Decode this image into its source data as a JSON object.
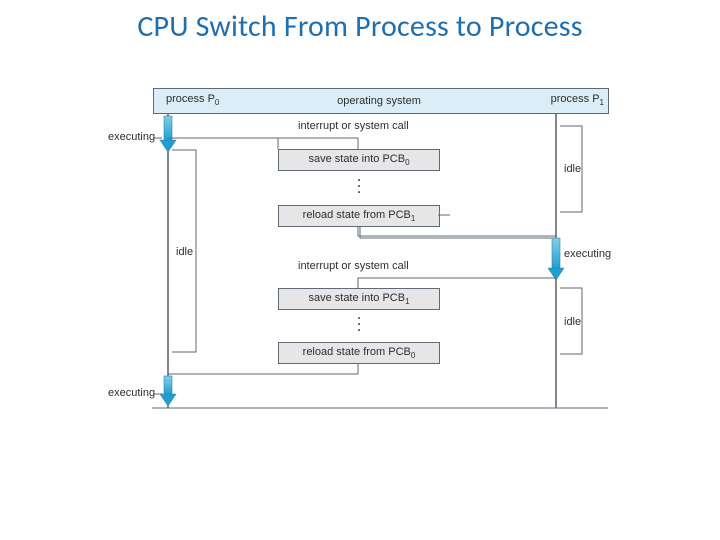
{
  "title": "CPU Switch From Process to Process",
  "header": {
    "p0": "process P",
    "p0_sub": "0",
    "os": "operating system",
    "p1": "process P",
    "p1_sub": "1"
  },
  "labels": {
    "intr1": "interrupt or system call",
    "intr2": "interrupt or system call",
    "executing1": "executing",
    "executing2": "executing",
    "executing3": "executing",
    "idle1": "idle",
    "idle2": "idle",
    "idle3": "idle"
  },
  "boxes": {
    "save0": "save state into PCB",
    "save0_sub": "0",
    "reload1": "reload state from PCB",
    "reload1_sub": "1",
    "save1": "save state into PCB",
    "save1_sub": "1",
    "reload0": "reload state from PCB",
    "reload0_sub": "0"
  },
  "dots": "•\n•\n•"
}
